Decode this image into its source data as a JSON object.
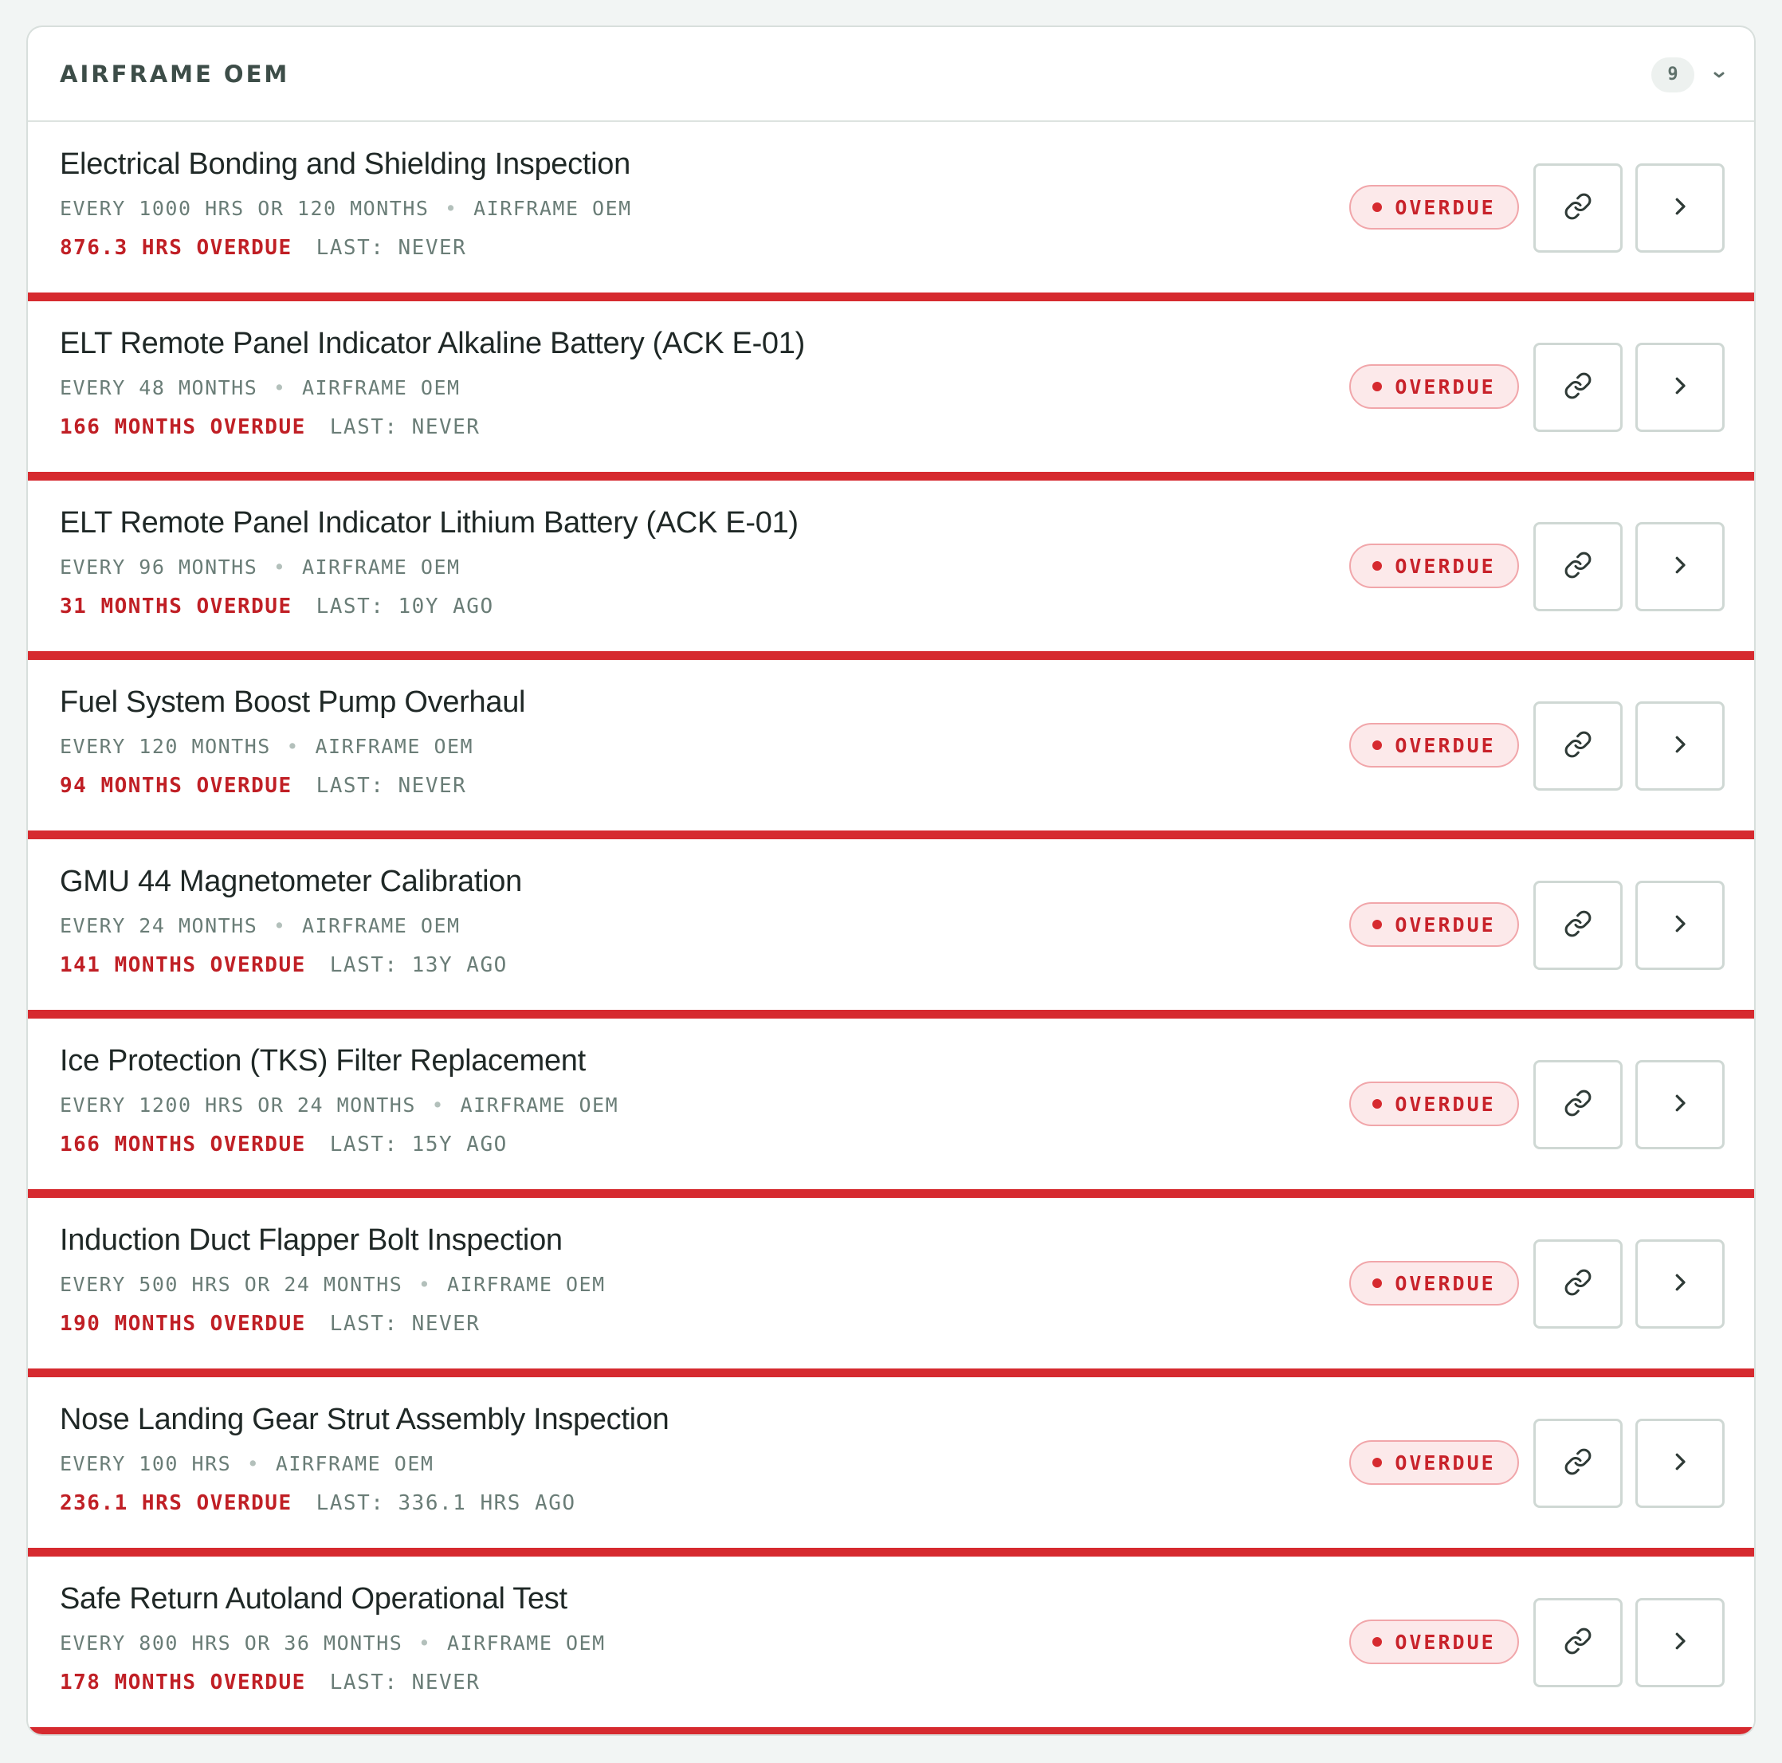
{
  "section": {
    "title": "AIRFRAME OEM",
    "count": "9",
    "toggle_icon": "chevron-down-icon"
  },
  "colors": {
    "overdue_red": "#d62a2f",
    "muted_text": "#6a7d77",
    "title_text": "#1f2826"
  },
  "icons": {
    "status_dot": "status-dot-icon",
    "link": "link-icon",
    "open": "chevron-right-icon"
  },
  "items": [
    {
      "title": "Electrical Bonding and Shielding Inspection",
      "interval": "EVERY 1000 HRS OR 120 MONTHS",
      "source": "AIRFRAME OEM",
      "due": "876.3 HRS OVERDUE",
      "last": "LAST: NEVER",
      "status": "OVERDUE"
    },
    {
      "title": "ELT Remote Panel Indicator Alkaline Battery (ACK E-01)",
      "interval": "EVERY 48 MONTHS",
      "source": "AIRFRAME OEM",
      "due": "166 MONTHS OVERDUE",
      "last": "LAST: NEVER",
      "status": "OVERDUE"
    },
    {
      "title": "ELT Remote Panel Indicator Lithium Battery (ACK E-01)",
      "interval": "EVERY 96 MONTHS",
      "source": "AIRFRAME OEM",
      "due": "31 MONTHS OVERDUE",
      "last": "LAST: 10Y AGO",
      "status": "OVERDUE"
    },
    {
      "title": "Fuel System Boost Pump Overhaul",
      "interval": "EVERY 120 MONTHS",
      "source": "AIRFRAME OEM",
      "due": "94 MONTHS OVERDUE",
      "last": "LAST: NEVER",
      "status": "OVERDUE"
    },
    {
      "title": "GMU 44 Magnetometer Calibration",
      "interval": "EVERY 24 MONTHS",
      "source": "AIRFRAME OEM",
      "due": "141 MONTHS OVERDUE",
      "last": "LAST: 13Y AGO",
      "status": "OVERDUE"
    },
    {
      "title": "Ice Protection (TKS) Filter Replacement",
      "interval": "EVERY 1200 HRS OR 24 MONTHS",
      "source": "AIRFRAME OEM",
      "due": "166 MONTHS OVERDUE",
      "last": "LAST: 15Y AGO",
      "status": "OVERDUE"
    },
    {
      "title": "Induction Duct Flapper Bolt Inspection",
      "interval": "EVERY 500 HRS OR 24 MONTHS",
      "source": "AIRFRAME OEM",
      "due": "190 MONTHS OVERDUE",
      "last": "LAST: NEVER",
      "status": "OVERDUE"
    },
    {
      "title": "Nose Landing Gear Strut Assembly Inspection",
      "interval": "EVERY 100 HRS",
      "source": "AIRFRAME OEM",
      "due": "236.1 HRS OVERDUE",
      "last": "LAST: 336.1 HRS AGO",
      "status": "OVERDUE"
    },
    {
      "title": "Safe Return Autoland Operational Test",
      "interval": "EVERY 800 HRS OR 36 MONTHS",
      "source": "AIRFRAME OEM",
      "due": "178 MONTHS OVERDUE",
      "last": "LAST: NEVER",
      "status": "OVERDUE"
    }
  ]
}
